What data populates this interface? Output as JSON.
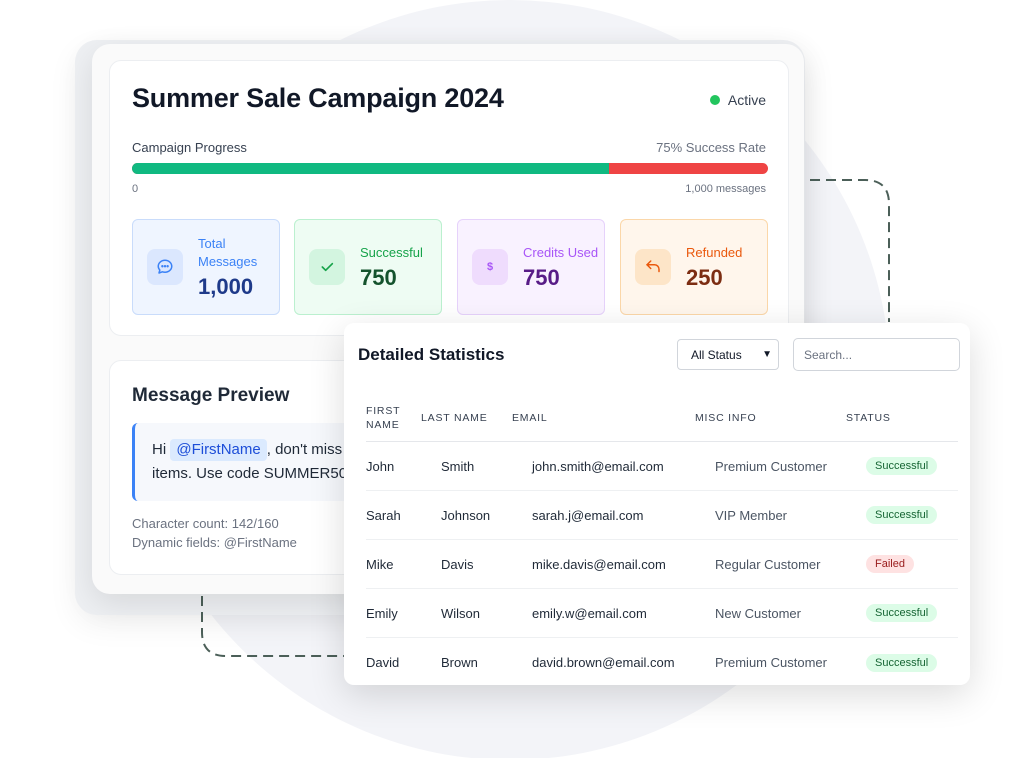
{
  "campaign": {
    "title": "Summer Sale Campaign 2024",
    "status": "Active",
    "progress_label": "Campaign Progress",
    "success_rate": "75% Success Rate",
    "progress_value": 0.75,
    "progress_min": "0",
    "progress_max": "1,000 messages",
    "stats": [
      {
        "label": "Total Messages",
        "value": "1,000",
        "icon": "message-bubble-icon"
      },
      {
        "label": "Successful",
        "value": "750",
        "icon": "check-icon"
      },
      {
        "label": "Credits Used",
        "value": "750",
        "icon": "dollar-icon"
      },
      {
        "label": "Refunded",
        "value": "250",
        "icon": "undo-arrow-icon"
      }
    ]
  },
  "preview": {
    "title": "Message Preview",
    "greeting": "Hi",
    "mention": "@FirstName",
    "line1_rest": ", don't miss",
    "line2": "items. Use code SUMMER50",
    "char_count": "Character count: 142/160",
    "dynamic_fields": "Dynamic fields: @FirstName"
  },
  "stats_panel": {
    "title": "Detailed Statistics",
    "filter_value": "All Status",
    "search_placeholder": "Search...",
    "columns": [
      "FIRST NAME",
      "LAST NAME",
      "EMAIL",
      "MISC INFO",
      "STATUS"
    ],
    "rows": [
      {
        "first": "John",
        "last": "Smith",
        "email": "john.smith@email.com",
        "misc": "Premium Customer",
        "status": "Successful"
      },
      {
        "first": "Sarah",
        "last": "Johnson",
        "email": "sarah.j@email.com",
        "misc": "VIP Member",
        "status": "Successful"
      },
      {
        "first": "Mike",
        "last": "Davis",
        "email": "mike.davis@email.com",
        "misc": "Regular Customer",
        "status": "Failed"
      },
      {
        "first": "Emily",
        "last": "Wilson",
        "email": "emily.w@email.com",
        "misc": "New Customer",
        "status": "Successful"
      },
      {
        "first": "David",
        "last": "Brown",
        "email": "david.brown@email.com",
        "misc": "Premium Customer",
        "status": "Successful"
      }
    ]
  },
  "colors": {
    "success": "#10b981",
    "failure": "#ef4444",
    "active_dot": "#22c55e",
    "accent": "#3b82f6"
  }
}
